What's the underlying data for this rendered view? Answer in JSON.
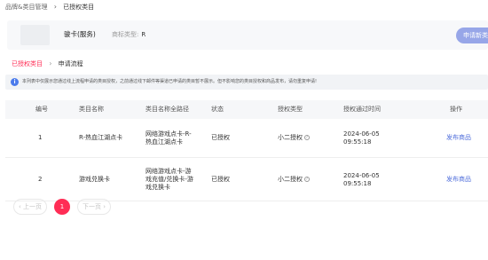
{
  "breadcrumb": {
    "parent": "品牌&类目管理",
    "separator": "›",
    "current": "已授权类目"
  },
  "shop": {
    "name": "骏卡(服务)",
    "brand_label": "商标类型:",
    "brand_value": "R",
    "apply_button": "申请新类目"
  },
  "tabs": {
    "active": "已授权类目",
    "separator": "›",
    "other": "申请流程"
  },
  "notice": {
    "icon": "info-icon",
    "text": "本列表中仅展示您通过线上流程申请的类目授权，之前通过线下邮件等渠道已申请的类目暂不展示。但不影响您的类目授权和商品发布，请勿重复申请!"
  },
  "table": {
    "headers": {
      "no": "编号",
      "name": "类目名称",
      "path": "类目名称全路径",
      "status": "状态",
      "auth_type": "授权类型",
      "auth_time": "授权通过时间",
      "action": "操作"
    },
    "rows": [
      {
        "no": "1",
        "name": "R-热血江湖点卡",
        "path": "网络游戏点卡-R-热血江湖点卡",
        "status": "已授权",
        "auth_type": "小二授权",
        "auth_time": "2024-06-05 09:55:18",
        "action": "发布商品"
      },
      {
        "no": "2",
        "name": "游戏兑换卡",
        "path": "网络游戏点卡-游戏充值/兑换卡-游戏兑换卡",
        "status": "已授权",
        "auth_type": "小二授权",
        "auth_time": "2024-06-05 09:55:18",
        "action": "发布商品"
      }
    ]
  },
  "pagination": {
    "prev": "‹ 上一页",
    "current": "1",
    "next": "下一页 ›"
  },
  "colors": {
    "accent": "#ff2d55",
    "primary_button": "#97a6e8",
    "link": "#4f6edb",
    "info": "#4b7bec"
  }
}
